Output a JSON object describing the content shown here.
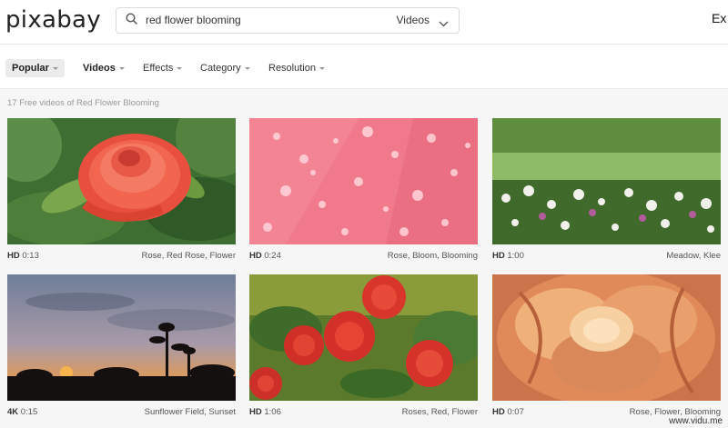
{
  "header": {
    "logo": "pixabay",
    "search_query": "red flower blooming",
    "search_type": "Videos",
    "explore": "Ex"
  },
  "filters": [
    {
      "label": "Popular",
      "active": true
    },
    {
      "label": "Videos",
      "bold": true
    },
    {
      "label": "Effects"
    },
    {
      "label": "Category"
    },
    {
      "label": "Resolution"
    }
  ],
  "results_count": "17 Free videos of Red Flower Blooming",
  "videos": [
    {
      "quality": "HD",
      "duration": "0:13",
      "tags": "Rose, Red Rose, Flower",
      "icon": "red-rose-thumbnail"
    },
    {
      "quality": "HD",
      "duration": "0:24",
      "tags": "Rose, Bloom, Blooming",
      "icon": "petal-water-drops-thumbnail"
    },
    {
      "quality": "HD",
      "duration": "1:00",
      "tags": "Meadow, Klee",
      "icon": "clover-meadow-thumbnail"
    },
    {
      "quality": "4K",
      "duration": "0:15",
      "tags": "Sunflower Field, Sunset",
      "icon": "sunflower-sunset-thumbnail"
    },
    {
      "quality": "HD",
      "duration": "1:06",
      "tags": "Roses, Red, Flower",
      "icon": "red-roses-bush-thumbnail"
    },
    {
      "quality": "HD",
      "duration": "0:07",
      "tags": "Rose, Flower, Blooming",
      "icon": "rose-closeup-thumbnail"
    }
  ],
  "watermark": "www.vidu.me"
}
